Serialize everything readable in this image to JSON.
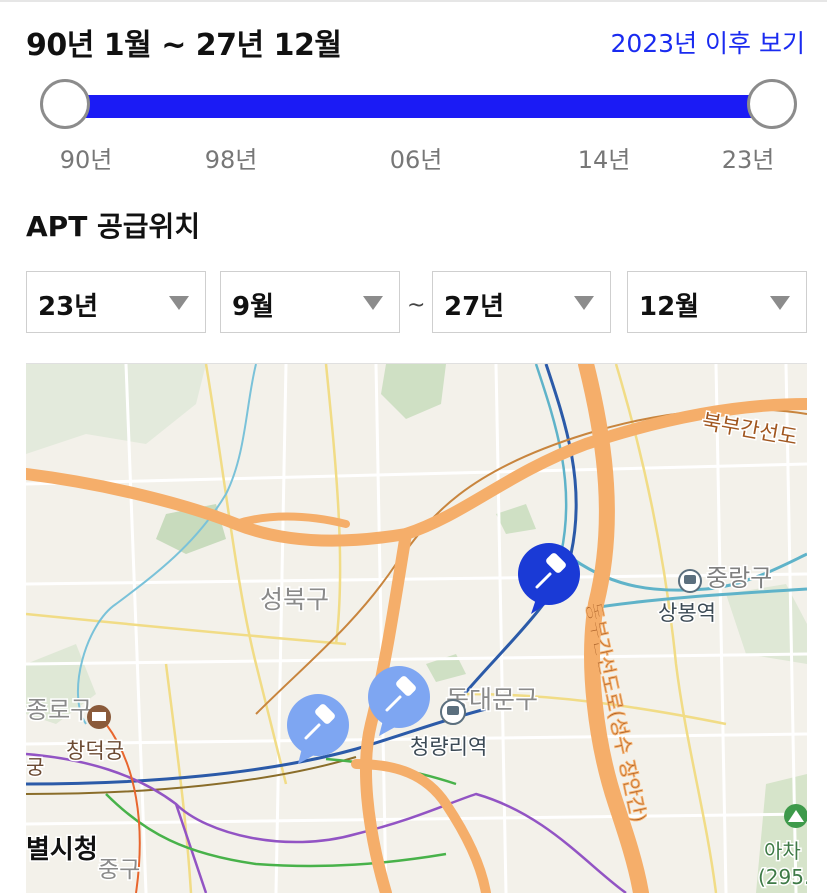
{
  "range": {
    "title": "90년 1월 ~ 27년 12월",
    "after_link": "2023년 이후 보기"
  },
  "slider": {
    "ticks": [
      "90년",
      "98년",
      "06년",
      "14년",
      "23년"
    ]
  },
  "supply": {
    "title": "APT 공급위치",
    "from_year": "23년",
    "from_month": "9월",
    "separator": "~",
    "to_year": "27년",
    "to_month": "12월"
  },
  "map": {
    "labels": {
      "road_north": "북부간선도",
      "jungnang": "중랑구",
      "sangbong": "상봉역",
      "seongbuk": "성북구",
      "expressway": "동부간선도로(성수 장안간)",
      "dongdaemun": "동대문구",
      "cheongnyangni": "청량리역",
      "jongno": "종로구",
      "changdeokgung": "창덕궁",
      "gu_left": "궁",
      "city_hall": "별시청",
      "junggu": "중구",
      "acha": "아차",
      "acha_height": "(295."
    }
  },
  "colors": {
    "accent": "#1b1bf5",
    "link": "#1a2bf0",
    "marker_active": "#1a3ad6",
    "marker": "#7ea6f2",
    "road_orange": "#f5ae6a"
  }
}
